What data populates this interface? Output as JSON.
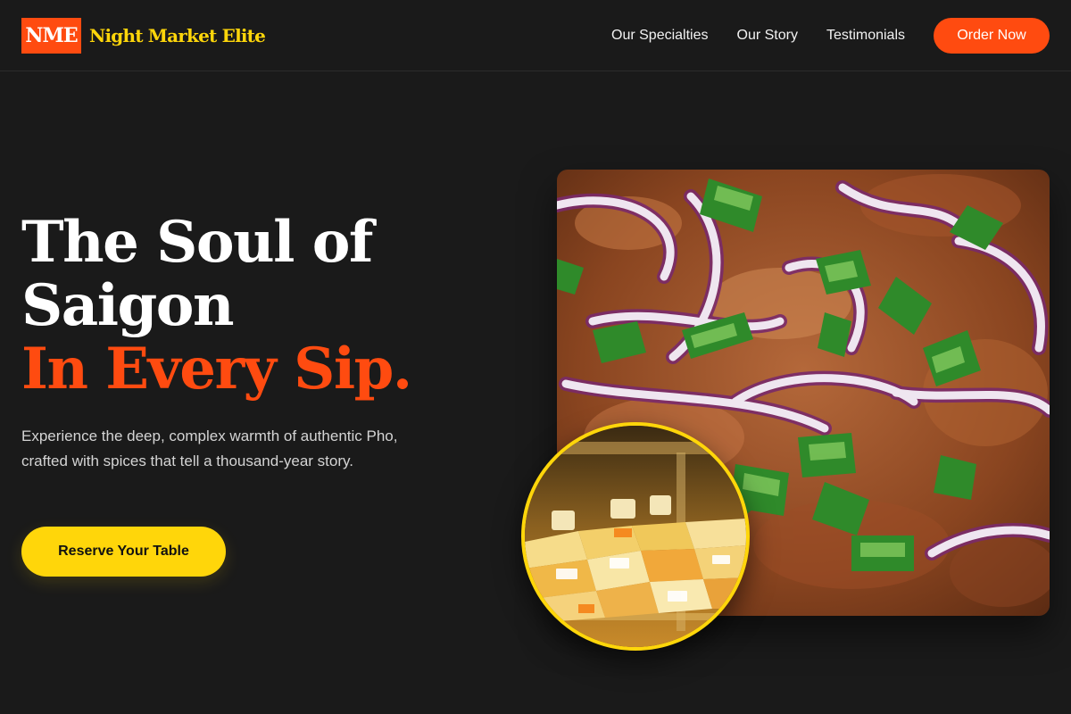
{
  "brand": {
    "mark": "NME",
    "name": "Night Market Elite",
    "accent_color": "#ff4b10",
    "secondary_color": "#ffd60a"
  },
  "nav": {
    "links": [
      "Our Specialties",
      "Our Story",
      "Testimonials"
    ],
    "cta_label": "Order Now"
  },
  "hero": {
    "title_line1": "The Soul of",
    "title_line2": "Saigon",
    "title_accent": "In Every Sip.",
    "description": "Experience the deep, complex warmth of authentic Pho, crafted with spices that tell a thousand-year story.",
    "cta_label": "Reserve Your Table"
  },
  "images": {
    "main": "food-photo-pork-red-onion-scallion",
    "inset": "market-stall-cheese-display"
  }
}
